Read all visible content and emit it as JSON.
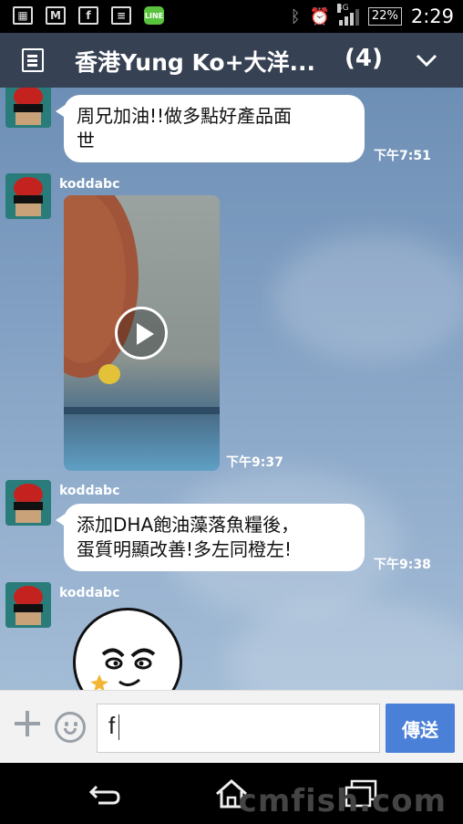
{
  "status_bar": {
    "battery": "22%",
    "network": "3G",
    "time": "2:29"
  },
  "header": {
    "title": "香港Yung Ko+大洋...",
    "member_count": "(4)"
  },
  "messages": [
    {
      "text_lines": [
        "周兄加油!!做多點好產品面",
        "世"
      ],
      "time": "下午7:51"
    },
    {
      "sender": "koddabc",
      "type": "video",
      "time": "下午9:37"
    },
    {
      "sender": "koddabc",
      "text_lines": [
        "添加DHA飽油藻落魚糧後，",
        "蛋質明顯改善!多左同橙左!"
      ],
      "time": "下午9:38"
    },
    {
      "sender": "koddabc",
      "type": "sticker"
    }
  ],
  "input": {
    "value": "f",
    "send_label": "傳送"
  },
  "watermark": "cmfish.com",
  "colors": {
    "header_bg": "#364153",
    "send_button": "#4a80d8",
    "chat_bg": "#7d9cc0"
  }
}
